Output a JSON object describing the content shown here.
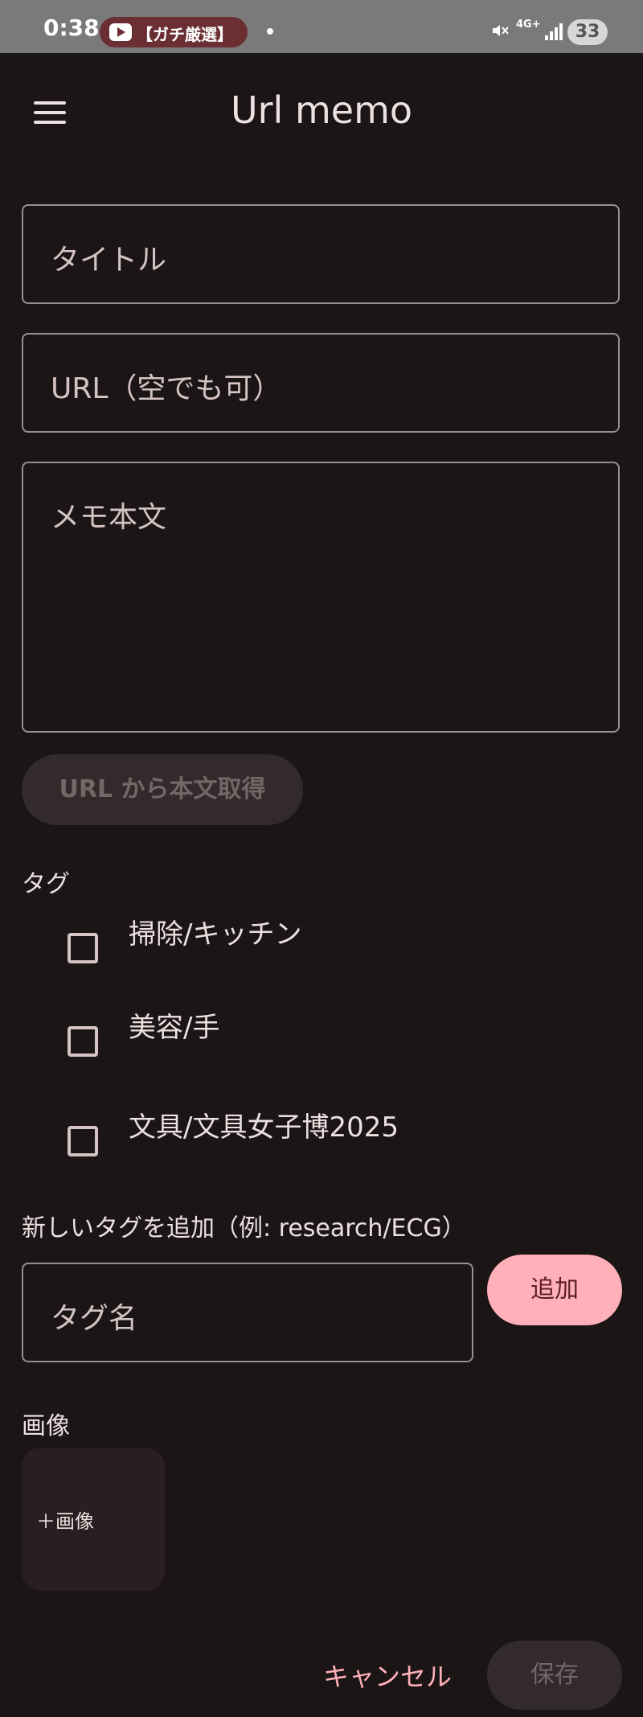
{
  "status_bar": {
    "time": "0:38",
    "notification": "【ガチ厳選】",
    "network": "4G+",
    "battery": "33"
  },
  "app": {
    "title": "Url memo"
  },
  "form": {
    "title_placeholder": "タイトル",
    "url_placeholder": "URL（空でも可）",
    "memo_placeholder": "メモ本文",
    "fetch_button": "URL から本文取得"
  },
  "tags": {
    "label": "タグ",
    "items": [
      {
        "label": "掃除/キッチン",
        "checked": false
      },
      {
        "label": "美容/手",
        "checked": false
      },
      {
        "label": "文具/文具女子博2025",
        "checked": false
      }
    ],
    "add_label": "新しいタグを追加（例: research/ECG）",
    "input_placeholder": "タグ名",
    "add_button": "追加"
  },
  "images": {
    "label": "画像",
    "add_tile": "＋画像"
  },
  "actions": {
    "cancel": "キャンセル",
    "save": "保存"
  },
  "colors": {
    "background": "#1c1516",
    "accent": "#ffb0b8",
    "disabled_bg": "#332a2b"
  }
}
